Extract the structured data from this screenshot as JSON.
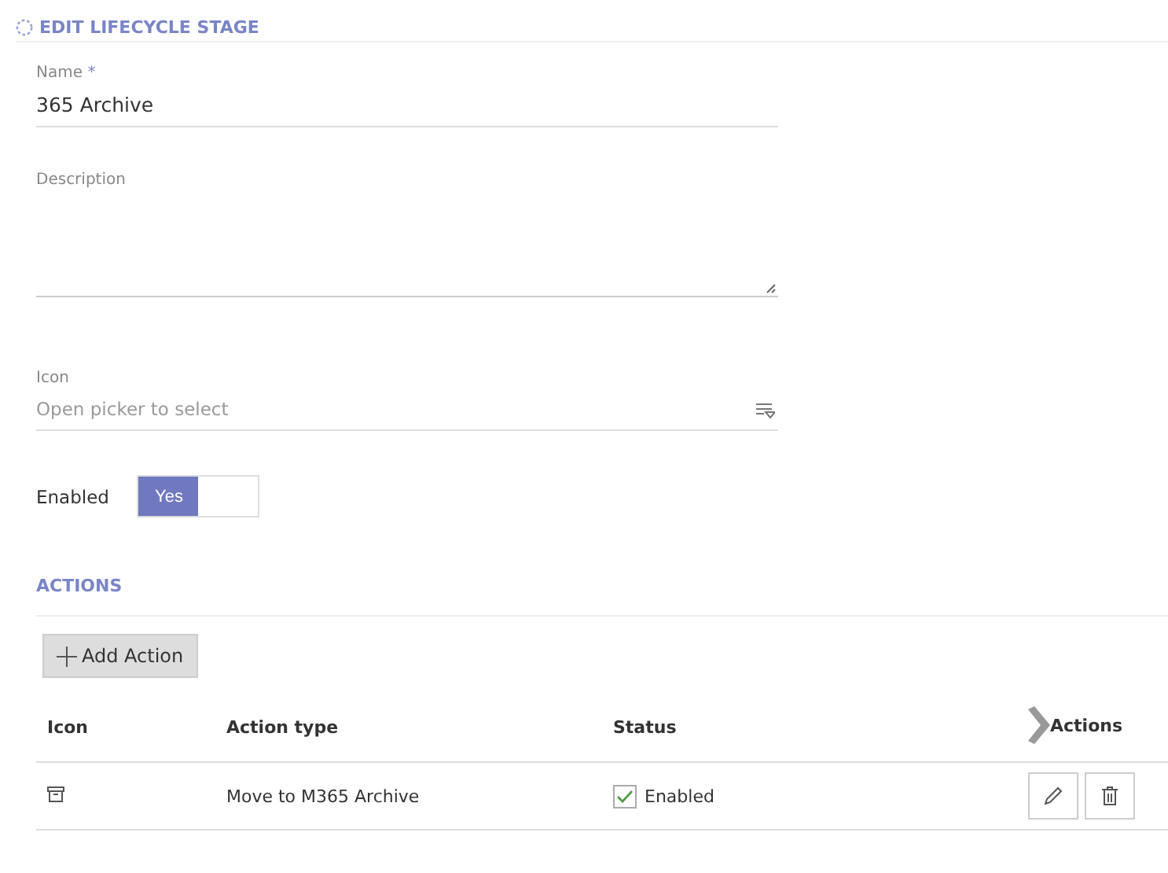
{
  "header": {
    "title": "EDIT LIFECYCLE STAGE"
  },
  "form": {
    "name": {
      "label": "Name",
      "required_mark": "*",
      "value": "365 Archive"
    },
    "description": {
      "label": "Description"
    },
    "icon": {
      "label": "Icon",
      "placeholder": "Open picker to select"
    },
    "enabled": {
      "label": "Enabled",
      "on_text": "Yes",
      "on": true
    }
  },
  "actions": {
    "title": "ACTIONS",
    "add_button": "Add Action",
    "table": {
      "columns": [
        "Icon",
        "Action type",
        "Status",
        "Actions"
      ],
      "rows": [
        {
          "action_type": "Move to M365 Archive",
          "status": "Enabled",
          "checked": true
        }
      ]
    }
  }
}
